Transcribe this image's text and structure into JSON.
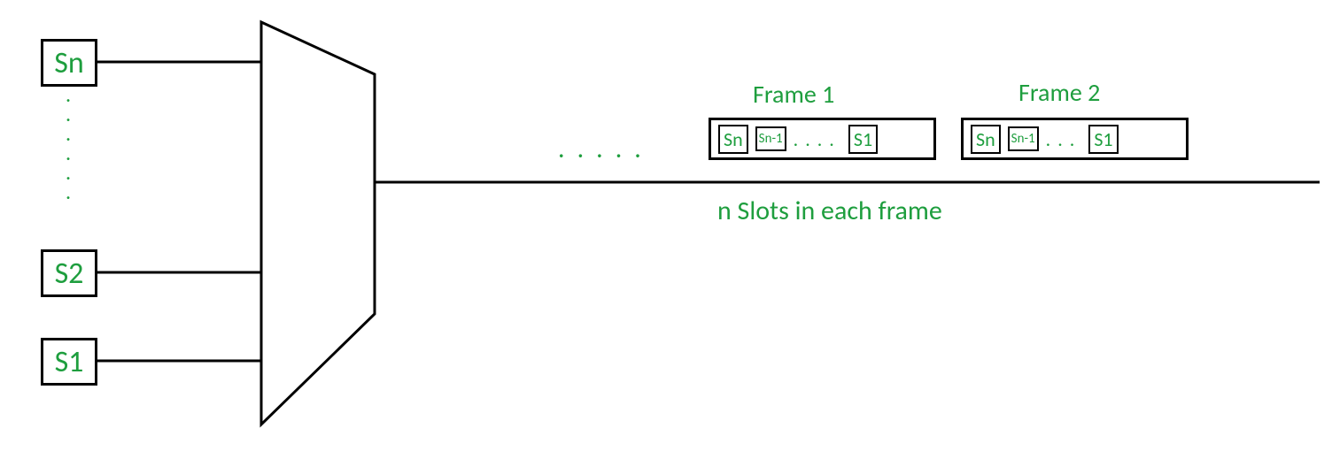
{
  "sources": {
    "topLabel": "Sn",
    "s2": "S2",
    "s1": "S1"
  },
  "frames": [
    {
      "title": "Frame 1",
      "slots": [
        "Sn",
        "Sn-1",
        "S1"
      ]
    },
    {
      "title": "Frame 2",
      "slots": [
        "Sn",
        "Sn-1",
        "S1"
      ]
    }
  ],
  "caption": "n Slots in each frame",
  "dotsV": "......",
  "dotsH": ".....",
  "frameDots": "....",
  "frameDots2": "..."
}
